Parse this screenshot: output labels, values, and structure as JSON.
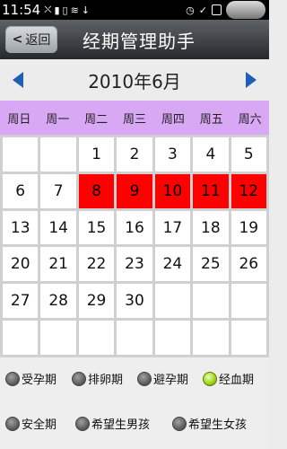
{
  "status_bar": {
    "time": "11:54",
    "icons": [
      "usb-icon",
      "android-debug-icon",
      "sd-card-icon",
      "wifi-icon",
      "download-icon"
    ],
    "right_icons": [
      "alarm-icon",
      "check-icon",
      "battery-icon"
    ]
  },
  "title_bar": {
    "back_label": "返回",
    "title": "经期管理助手"
  },
  "month_nav": {
    "label": "2010年6月"
  },
  "weekdays": [
    "周日",
    "周一",
    "周二",
    "周三",
    "周四",
    "周五",
    "周六"
  ],
  "calendar": {
    "rows": [
      [
        "",
        "",
        "1",
        "2",
        "3",
        "4",
        "5"
      ],
      [
        "6",
        "7",
        "8",
        "9",
        "10",
        "11",
        "12"
      ],
      [
        "13",
        "14",
        "15",
        "16",
        "17",
        "18",
        "19"
      ],
      [
        "20",
        "21",
        "22",
        "23",
        "24",
        "25",
        "26"
      ],
      [
        "27",
        "28",
        "29",
        "30",
        "",
        "",
        ""
      ],
      [
        "",
        "",
        "",
        "",
        "",
        "",
        ""
      ]
    ],
    "highlighted_days": [
      "8",
      "9",
      "10",
      "11",
      "12"
    ],
    "highlight_color": "#ff0000"
  },
  "legend": {
    "items": [
      {
        "label": "受孕期",
        "selected": false
      },
      {
        "label": "排卵期",
        "selected": false
      },
      {
        "label": "避孕期",
        "selected": false
      },
      {
        "label": "经血期",
        "selected": true
      },
      {
        "label": "安全期",
        "selected": false
      },
      {
        "label": "希望生男孩",
        "selected": false
      },
      {
        "label": "希望生女孩",
        "selected": false
      }
    ]
  },
  "colors": {
    "weekday_header_bg": "#d9a8f5",
    "nav_arrow": "#1e5fb8",
    "selected_radio": "#9bd30f"
  }
}
